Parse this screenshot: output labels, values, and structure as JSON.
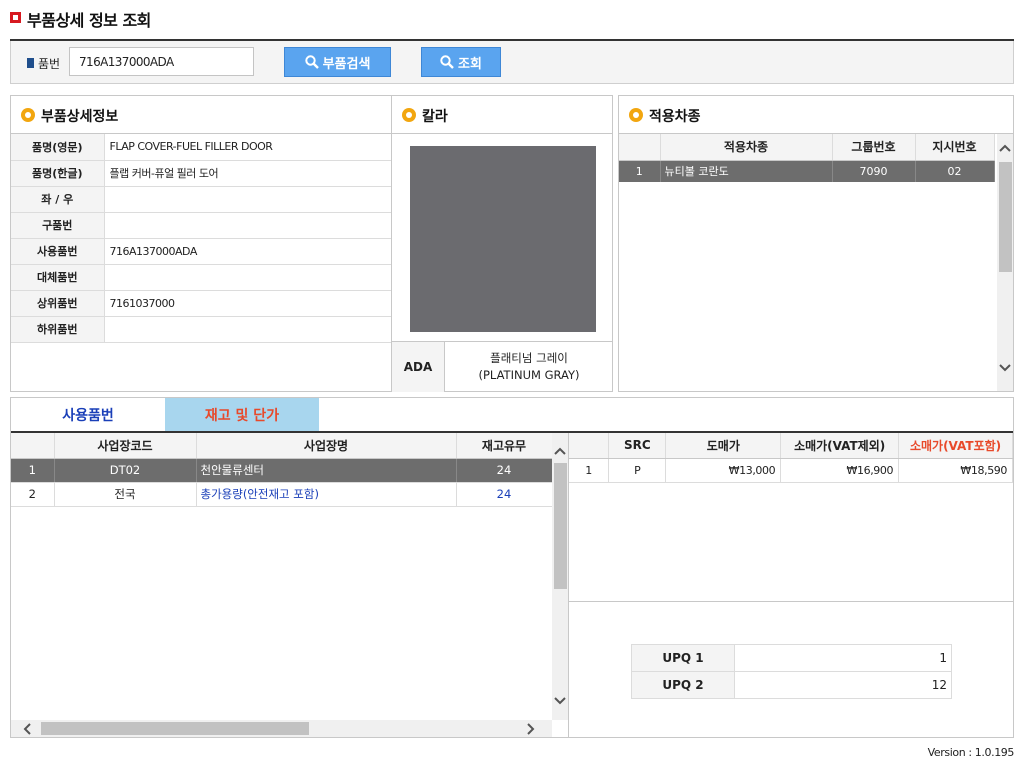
{
  "page": {
    "title": "부품상세 정보 조회",
    "version": "Version : 1.0.195"
  },
  "search": {
    "label": "품번",
    "part_number_value": "716A137000ADA",
    "part_search_button": "부품검색",
    "lookup_button": "조회"
  },
  "details": {
    "title": "부품상세정보",
    "rows": [
      {
        "label": "품명(영문)",
        "value": "FLAP COVER-FUEL FILLER DOOR"
      },
      {
        "label": "품명(한글)",
        "value": "플랩 커버-퓨얼 필러 도어"
      },
      {
        "label": "좌 / 우",
        "value": ""
      },
      {
        "label": "구품번",
        "value": ""
      },
      {
        "label": "사용품번",
        "value": "716A137000ADA"
      },
      {
        "label": "대체품번",
        "value": ""
      },
      {
        "label": "상위품번",
        "value": "7161037000"
      },
      {
        "label": "하위품번",
        "value": ""
      }
    ]
  },
  "color": {
    "title": "칼라",
    "code": "ADA",
    "name_line1": "플래티넘 그레이",
    "name_line2": "(PLATINUM GRAY)",
    "swatch_color": "#6b6b6f"
  },
  "vehicles": {
    "title": "적용차종",
    "columns": [
      "",
      "적용차종",
      "그룹번호",
      "지시번호"
    ],
    "rows": [
      {
        "no": "1",
        "model": "뉴티볼 코란도",
        "group": "7090",
        "instruction": "02"
      }
    ]
  },
  "tabs": {
    "used_parts": "사용품번",
    "stock_price": "재고 및 단가"
  },
  "stock": {
    "columns": [
      "",
      "사업장코드",
      "사업장명",
      "재고유무"
    ],
    "rows": [
      {
        "no": "1",
        "code": "DT02",
        "name": "천안물류센터",
        "qty": "24"
      },
      {
        "no": "2",
        "code": "전국",
        "name": "총가용량(안전재고 포함)",
        "qty": "24"
      }
    ]
  },
  "price": {
    "columns": [
      "",
      "SRC",
      "도매가",
      "소매가(VAT제외)",
      "소매가(VAT포함)"
    ],
    "rows": [
      {
        "no": "1",
        "src": "P",
        "wholesale": "₩13,000",
        "retail_ex": "₩16,900",
        "retail_inc": "₩18,590"
      }
    ]
  },
  "upq": [
    {
      "label": "UPQ 1",
      "value": "1"
    },
    {
      "label": "UPQ 2",
      "value": "12"
    }
  ],
  "colors": {
    "accent_blue": "#5aa4ef",
    "selected_row": "#6d6d6d",
    "section_icon": "#f2a60f",
    "active_tab": "#a8d6ee",
    "red_text": "#e8492a",
    "title_mark": "#d71920"
  }
}
